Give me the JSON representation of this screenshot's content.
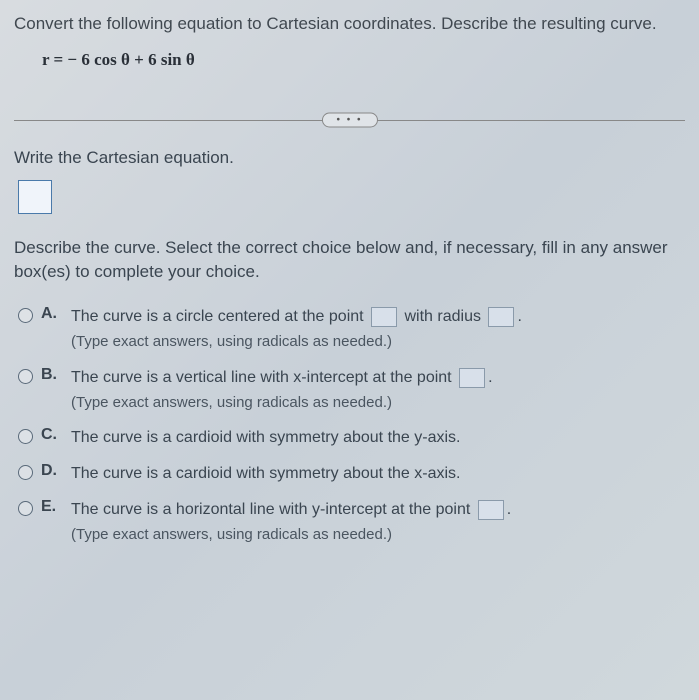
{
  "question": {
    "prompt": "Convert the following equation to Cartesian coordinates. Describe the resulting curve.",
    "equation": "r = − 6 cos θ + 6 sin θ"
  },
  "divider": "• • •",
  "section1": {
    "label": "Write the Cartesian equation."
  },
  "section2": {
    "instruction": "Describe the curve. Select the correct choice below and, if necessary, fill in any answer box(es) to complete your choice."
  },
  "choices": [
    {
      "letter": "A.",
      "text_before": "The curve is a circle centered at the point",
      "text_middle": "with radius",
      "text_after": ".",
      "hint": "(Type exact answers, using radicals as needed.)",
      "boxes": 2
    },
    {
      "letter": "B.",
      "text_before": "The curve is a vertical line with x-intercept at the point",
      "text_after": ".",
      "hint": "(Type exact answers, using radicals as needed.)",
      "boxes": 1
    },
    {
      "letter": "C.",
      "text_before": "The curve is a cardioid with symmetry about the y-axis.",
      "boxes": 0
    },
    {
      "letter": "D.",
      "text_before": "The curve is a cardioid with symmetry about the x-axis.",
      "boxes": 0
    },
    {
      "letter": "E.",
      "text_before": "The curve is a horizontal line with y-intercept at the point",
      "text_after": ".",
      "hint": "(Type exact answers, using radicals as needed.)",
      "boxes": 1
    }
  ]
}
